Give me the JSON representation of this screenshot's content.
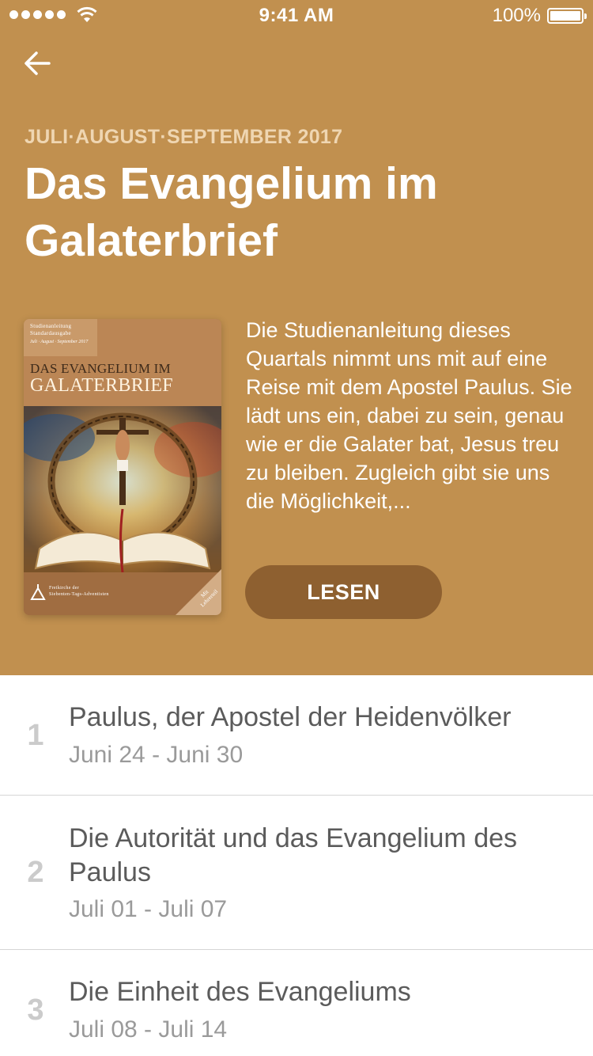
{
  "status_bar": {
    "time": "9:41 AM",
    "battery": "100%"
  },
  "header": {
    "quarter": "JULI·AUGUST·SEPTEMBER 2017",
    "title": "Das Evangelium im Galaterbrief",
    "description": "Die Studienanleitung dieses Quartals nimmt uns mit auf eine Reise mit dem Apostel Paulus. Sie lädt uns ein, dabei zu sein, genau wie er die Galater bat, Jesus treu zu bleiben. Zugleich gibt sie uns die Möglichkeit,...",
    "read_button": "LESEN",
    "bg_color": "#c1904f",
    "button_color": "#8e6030"
  },
  "cover": {
    "label_line1": "Studienanleitung",
    "label_line2": "Standardausgabe",
    "label_dates": "Juli · August · September 2017",
    "title_line1": "DAS EVANGELIUM IM",
    "title_line2": "GALATERBRIEF",
    "church_line1": "Freikirche der",
    "church_line2": "Siebenten-Tags-Adventisten",
    "corner_line1": "Mit",
    "corner_line2": "Lehrerteil"
  },
  "lessons": [
    {
      "number": "1",
      "title": "Paulus, der Apostel der Heidenvölker",
      "dates": "Juni 24 - Juni 30"
    },
    {
      "number": "2",
      "title": "Die Autorität und das Evangelium des Paulus",
      "dates": "Juli 01 - Juli 07"
    },
    {
      "number": "3",
      "title": "Die Einheit des Evangeliums",
      "dates": "Juli 08 - Juli 14"
    }
  ]
}
